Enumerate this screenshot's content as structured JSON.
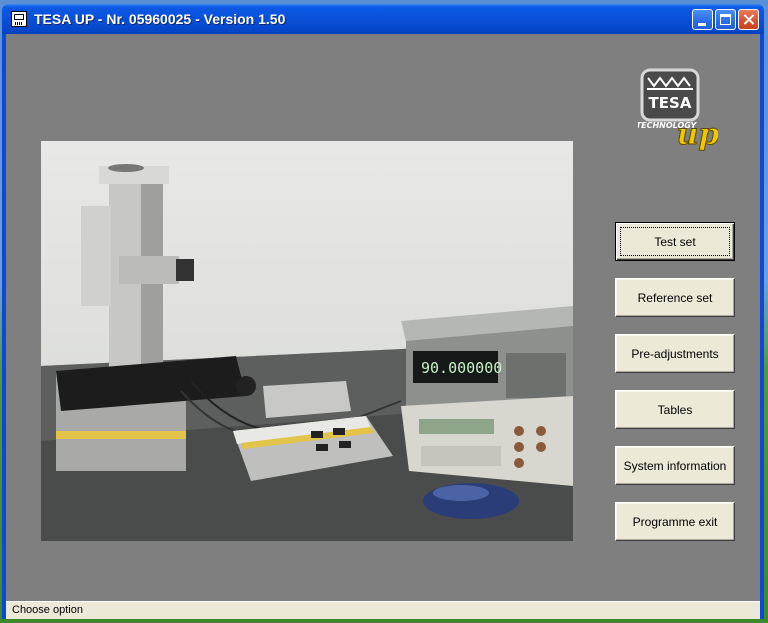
{
  "window": {
    "title": "TESA UP - Nr. 05960025 - Version 1.50",
    "icon": "app-calculator-icon"
  },
  "logo": {
    "brand": "TESA",
    "tagline": "TECHNOLOGY",
    "mark": "up"
  },
  "display": {
    "readout": "90.000000"
  },
  "menu": {
    "buttons": [
      {
        "label": "Test set",
        "focused": true
      },
      {
        "label": "Reference set"
      },
      {
        "label": "Pre-adjustments"
      },
      {
        "label": "Tables"
      },
      {
        "label": "System information"
      },
      {
        "label": "Programme exit"
      }
    ]
  },
  "status": {
    "text": "Choose option"
  },
  "colors": {
    "client_bg": "#7f7f7f",
    "button_face": "#ece9d8",
    "titlebar": "#0a50d8"
  }
}
